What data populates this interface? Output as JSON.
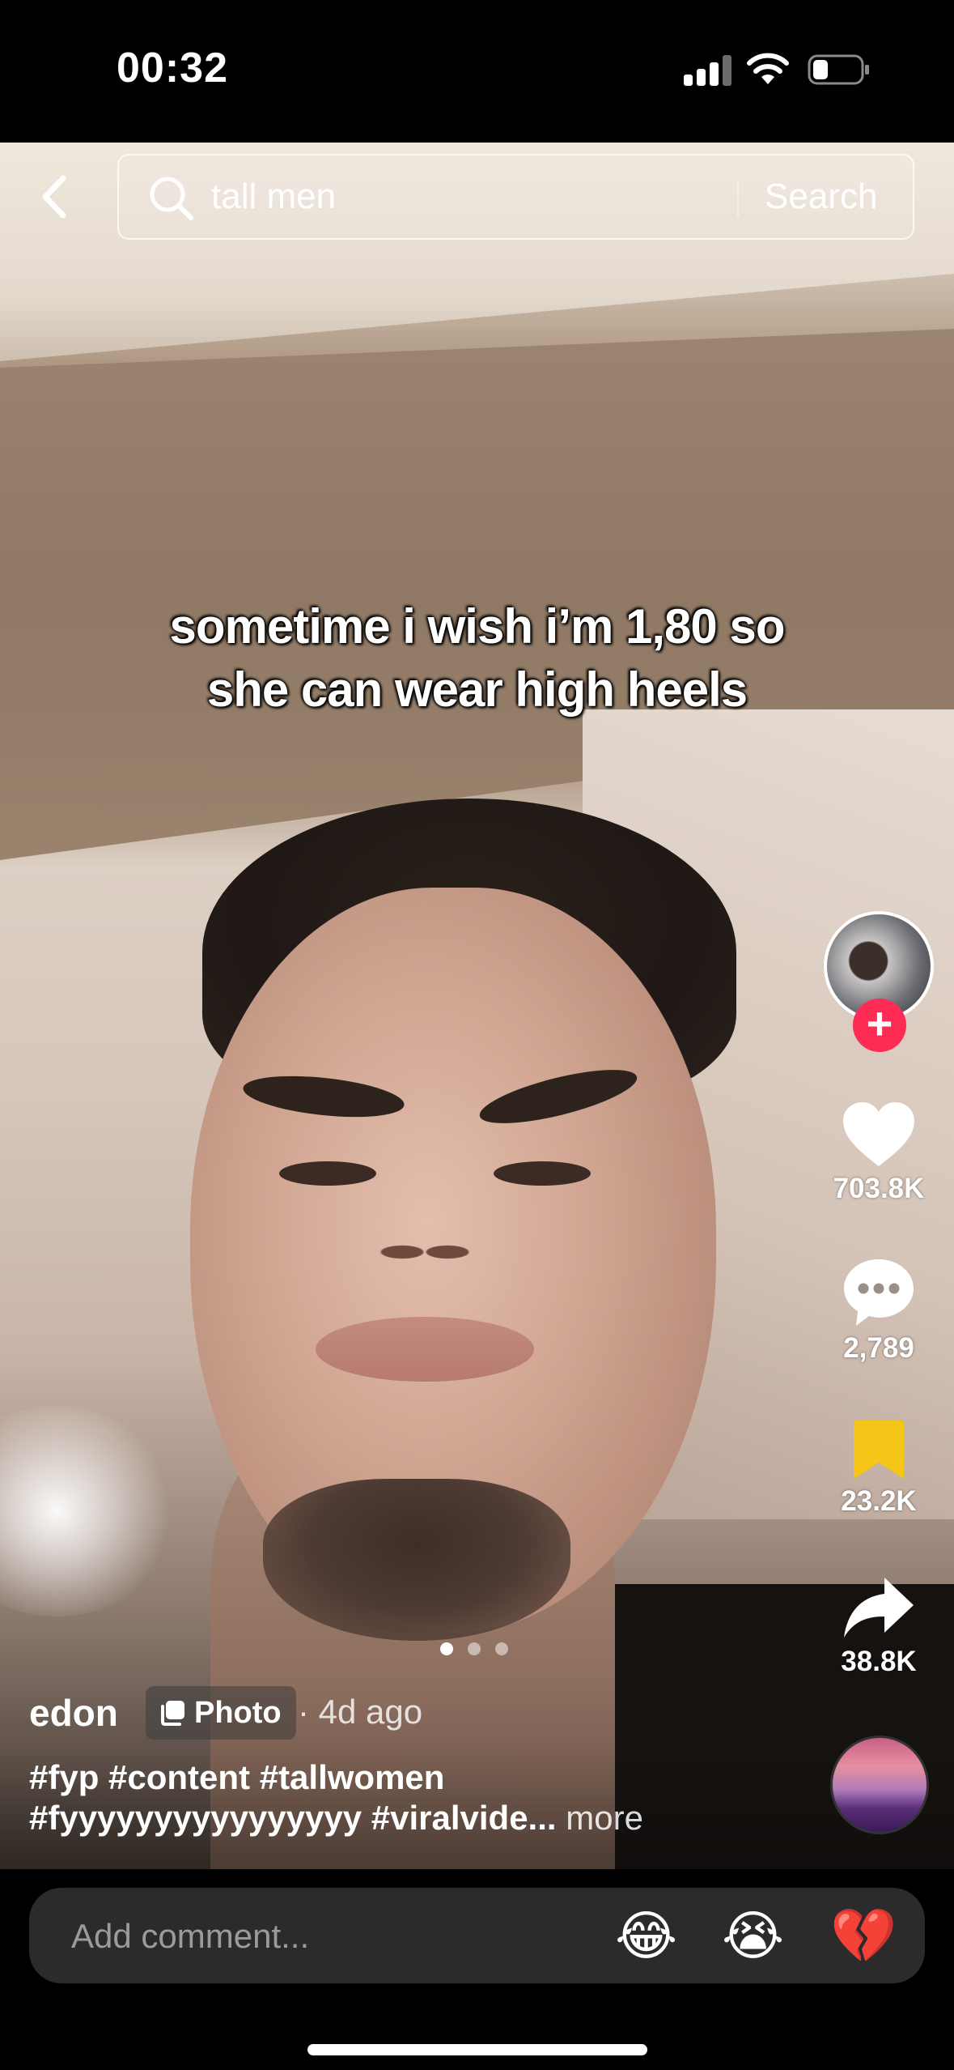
{
  "status_bar": {
    "time": "00:32",
    "signal_bars": 3,
    "battery_level": 0.25
  },
  "header": {
    "search_query": "tall men",
    "search_button": "Search"
  },
  "post": {
    "caption_line1": "sometime i wish i’m 1,80 so",
    "caption_line2": "she can wear high heels",
    "author": "edon",
    "type_badge": "Photo",
    "age": "· 4d ago",
    "description_line1": "#fyp #content #tallwomen",
    "description_line2": "#fyyyyyyyyyyyyyyyy #viralvide...",
    "more_label": "more",
    "carousel": {
      "pages": 3,
      "current": 1
    }
  },
  "actions": {
    "likes": "703.8K",
    "comments": "2,789",
    "saves": "23.2K",
    "shares": "38.8K"
  },
  "comment_bar": {
    "placeholder": "Add comment...",
    "emojis": [
      "😂",
      "😭",
      "💔"
    ]
  },
  "colors": {
    "follow_accent": "#fe2c55",
    "save_icon": "#f5c518"
  }
}
